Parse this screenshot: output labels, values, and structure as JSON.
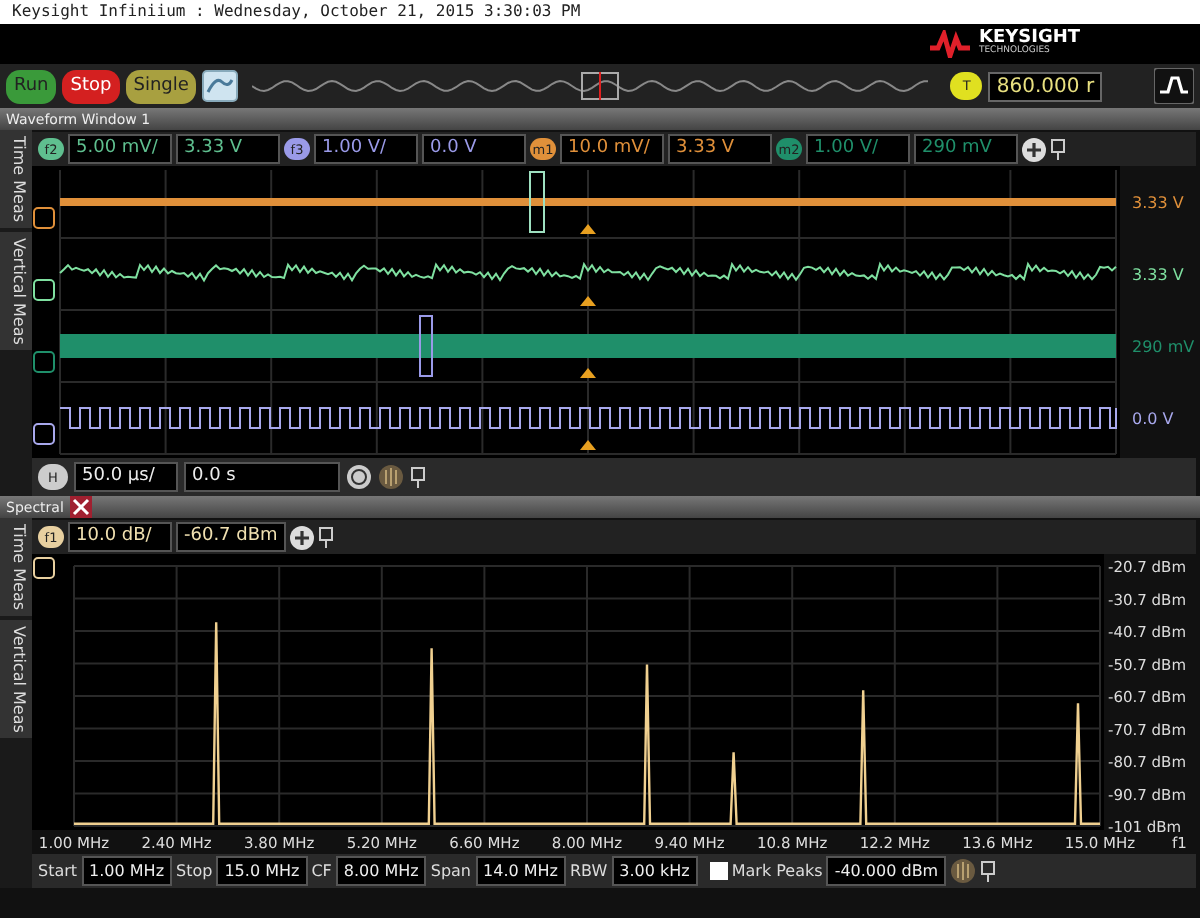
{
  "window": {
    "title": "Keysight Infiniium : Wednesday, October 21, 2015 3:30:03 PM"
  },
  "brand": {
    "name": "KEYSIGHT",
    "tagline": "TECHNOLOGIES"
  },
  "toolbar": {
    "buttons": [
      {
        "label": "Run",
        "kind": "run"
      },
      {
        "label": "Stop",
        "kind": "stop"
      },
      {
        "label": "Single",
        "kind": "single"
      }
    ],
    "trigger": {
      "badge": "T",
      "value": "860.000 r"
    }
  },
  "waveform_window": {
    "title": "Waveform Window 1",
    "side_tabs": [
      "Time Meas",
      "Vertical Meas"
    ],
    "channels": [
      {
        "badge": "f2",
        "scale": "5.00 mV/",
        "offset": "3.33 V",
        "color": "#5fbf8f"
      },
      {
        "badge": "f3",
        "scale": "1.00 V/",
        "offset": "0.0 V",
        "color": "#9a9ae8"
      },
      {
        "badge": "m1",
        "scale": "10.0 mV/",
        "offset": "3.33 V",
        "color": "#e0903a"
      },
      {
        "badge": "m2",
        "scale": "1.00 V/",
        "offset": "290 mV",
        "color": "#1f8f6a"
      }
    ],
    "traces": [
      {
        "kind": "flat",
        "label": "3.33 V",
        "color": "#e0903a"
      },
      {
        "kind": "ripple",
        "label": "3.33 V",
        "color": "#7fe0a0"
      },
      {
        "kind": "band",
        "label": "290 mV",
        "color": "#1f8f6a"
      },
      {
        "kind": "square",
        "label": "0.0 V",
        "color": "#a8a8ec"
      }
    ],
    "horizontal": {
      "badge": "H",
      "scale": "50.0 µs/",
      "position": "0.0 s"
    }
  },
  "spectral": {
    "title": "Spectral",
    "side_tabs": [
      "Time Meas",
      "Vertical Meas"
    ],
    "channel": {
      "badge": "f1",
      "scale": "10.0 dB/",
      "offset": "-60.7 dBm"
    },
    "chart_data": {
      "type": "line",
      "grid": true,
      "xlim": [
        1,
        15
      ],
      "ylim": [
        -100.7,
        -20.7
      ],
      "xticks": [
        {
          "value": 1,
          "label": "1.00 MHz"
        },
        {
          "value": 2.4,
          "label": "2.40 MHz"
        },
        {
          "value": 3.8,
          "label": "3.80 MHz"
        },
        {
          "value": 5.2,
          "label": "5.20 MHz"
        },
        {
          "value": 6.6,
          "label": "6.60 MHz"
        },
        {
          "value": 8,
          "label": "8.00 MHz"
        },
        {
          "value": 9.4,
          "label": "9.40 MHz"
        },
        {
          "value": 10.8,
          "label": "10.8 MHz"
        },
        {
          "value": 12.2,
          "label": "12.2 MHz"
        },
        {
          "value": 13.6,
          "label": "13.6 MHz"
        },
        {
          "value": 15,
          "label": "15.0 MHz"
        }
      ],
      "yticks": [
        {
          "value": -20.7,
          "label": "-20.7 dBm"
        },
        {
          "value": -30.7,
          "label": "-30.7 dBm"
        },
        {
          "value": -40.7,
          "label": "-40.7 dBm"
        },
        {
          "value": -50.7,
          "label": "-50.7 dBm"
        },
        {
          "value": -60.7,
          "label": "-60.7 dBm"
        },
        {
          "value": -70.7,
          "label": "-70.7 dBm"
        },
        {
          "value": -80.7,
          "label": "-80.7 dBm"
        },
        {
          "value": -90.7,
          "label": "-90.7 dBm"
        },
        {
          "value": -100.7,
          "label": "-101 dBm"
        }
      ],
      "series": [
        {
          "name": "f1",
          "color": "#f0d090",
          "x": [
            1,
            2.9,
            2.94,
            2.98,
            5.84,
            5.88,
            5.92,
            8.78,
            8.82,
            8.86,
            9.96,
            10,
            10.04,
            11.73,
            11.77,
            11.81,
            14.66,
            14.7,
            14.74,
            15
          ],
          "values": [
            -100,
            -100,
            -38,
            -100,
            -100,
            -46,
            -100,
            -100,
            -51,
            -100,
            -100,
            -78,
            -100,
            -100,
            -59,
            -100,
            -100,
            -63,
            -100,
            -100
          ]
        }
      ]
    }
  },
  "footer": {
    "fields": [
      {
        "label": "Start",
        "value": "1.00 MHz"
      },
      {
        "label": "Stop",
        "value": "15.0 MHz"
      },
      {
        "label": "CF",
        "value": "8.00 MHz"
      },
      {
        "label": "Span",
        "value": "14.0 MHz"
      },
      {
        "label": "RBW",
        "value": "3.00 kHz"
      }
    ],
    "mark_peaks": {
      "label": "Mark Peaks",
      "checked": false
    },
    "threshold": "-40.000 dBm"
  }
}
